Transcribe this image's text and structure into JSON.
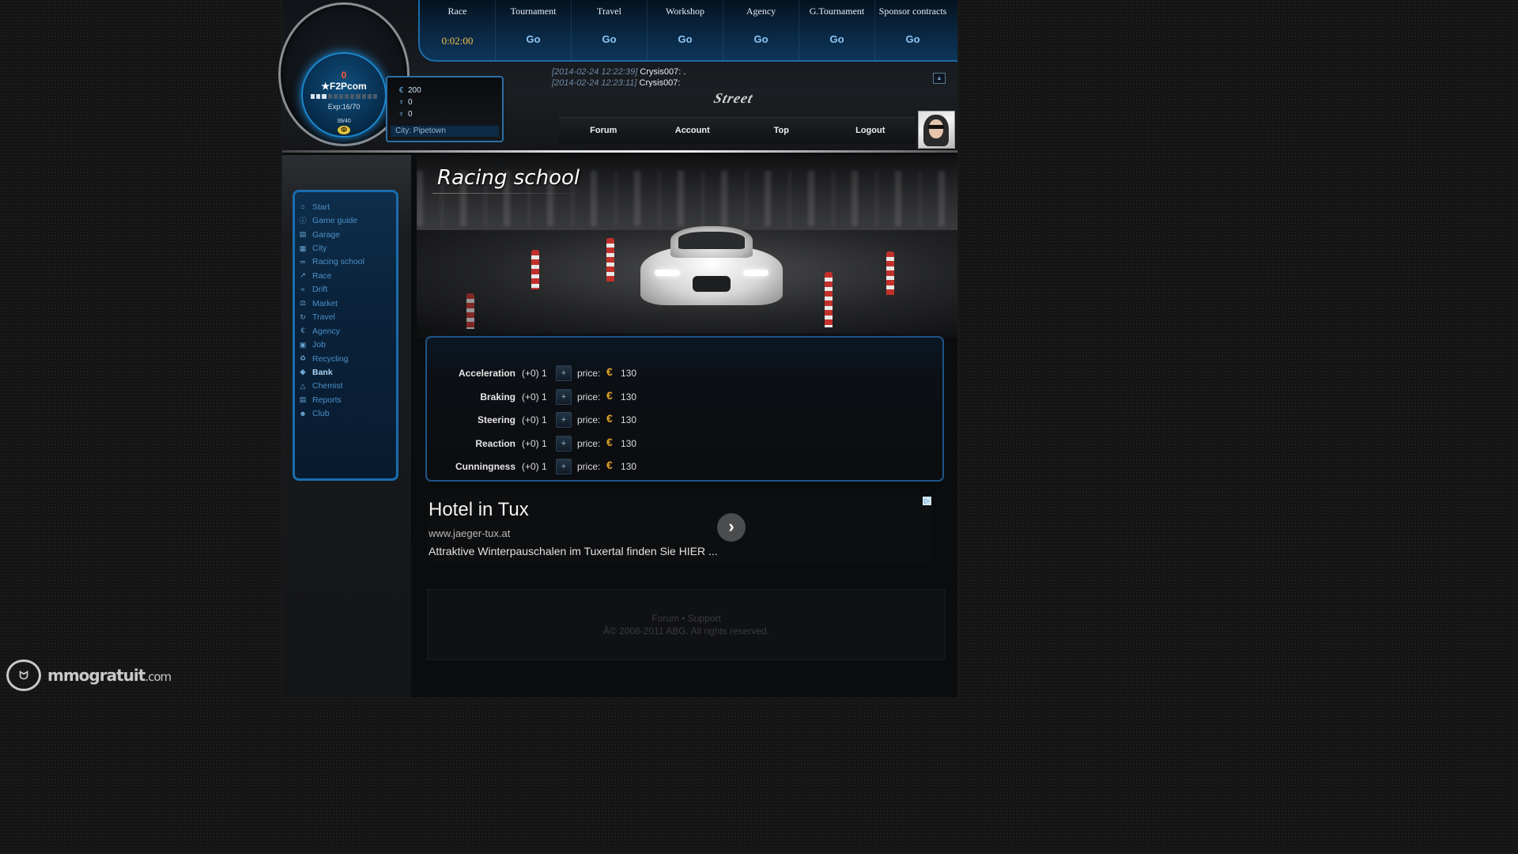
{
  "topnav": [
    {
      "label": "Race",
      "value": "0:02:00",
      "kind": "timer"
    },
    {
      "label": "Tournament",
      "value": "Go",
      "kind": "go"
    },
    {
      "label": "Travel",
      "value": "Go",
      "kind": "go"
    },
    {
      "label": "Workshop",
      "value": "Go",
      "kind": "go"
    },
    {
      "label": "Agency",
      "value": "Go",
      "kind": "go"
    },
    {
      "label": "G.Tournament",
      "value": "Go",
      "kind": "go"
    },
    {
      "label": "Sponsor contracts",
      "value": "Go",
      "kind": "go"
    }
  ],
  "player": {
    "level_number": "0",
    "name": "★F2Pcom",
    "exp": "Exp:16/70",
    "exp_progress": 0.23,
    "energy": "39/40",
    "coin_glyph": "Ф"
  },
  "stats": {
    "money": "200",
    "stat2": "0",
    "stat3": "0",
    "city": "City: Pipetown"
  },
  "chat": [
    {
      "time": "[2014-02-24 12:22:39]",
      "user": "Crysis007: ."
    },
    {
      "time": "[2014-02-24 12:23:11]",
      "user": "Crysis007:"
    }
  ],
  "logo_text": "Street",
  "menu": [
    "Forum",
    "Account",
    "Top",
    "Logout"
  ],
  "sidebar": [
    {
      "label": "Start",
      "icon": "home-icon",
      "glyph": "⌂"
    },
    {
      "label": "Game guide",
      "icon": "info-icon",
      "glyph": "ⓘ"
    },
    {
      "label": "Garage",
      "icon": "garage-icon",
      "glyph": "▤"
    },
    {
      "label": "City",
      "icon": "city-icon",
      "glyph": "▦"
    },
    {
      "label": "Racing school",
      "icon": "school-icon",
      "glyph": "═"
    },
    {
      "label": "Race",
      "icon": "race-icon",
      "glyph": "↗"
    },
    {
      "label": "Drift",
      "icon": "drift-icon",
      "glyph": "≈"
    },
    {
      "label": "Market",
      "icon": "market-icon",
      "glyph": "⚖"
    },
    {
      "label": "Travel",
      "icon": "travel-icon",
      "glyph": "↻"
    },
    {
      "label": "Agency",
      "icon": "euro-icon",
      "glyph": "€"
    },
    {
      "label": "Job",
      "icon": "briefcase-icon",
      "glyph": "▣"
    },
    {
      "label": "Recycling",
      "icon": "recycle-icon",
      "glyph": "♻"
    },
    {
      "label": "Bank",
      "icon": "bank-icon",
      "glyph": "◆",
      "active": true
    },
    {
      "label": "Chemist",
      "icon": "flask-icon",
      "glyph": "△"
    },
    {
      "label": "Reports",
      "icon": "report-icon",
      "glyph": "▤"
    },
    {
      "label": "Club",
      "icon": "club-icon",
      "glyph": "☻"
    }
  ],
  "page": {
    "title": "Racing school"
  },
  "skills": [
    {
      "name": "Acceleration",
      "level": "(+0) 1",
      "plus": "+",
      "price_label": "price:",
      "currency": "€",
      "price": "130"
    },
    {
      "name": "Braking",
      "level": "(+0) 1",
      "plus": "+",
      "price_label": "price:",
      "currency": "€",
      "price": "130"
    },
    {
      "name": "Steering",
      "level": "(+0) 1",
      "plus": "+",
      "price_label": "price:",
      "currency": "€",
      "price": "130"
    },
    {
      "name": "Reaction",
      "level": "(+0) 1",
      "plus": "+",
      "price_label": "price:",
      "currency": "€",
      "price": "130"
    },
    {
      "name": "Cunningness",
      "level": "(+0) 1",
      "plus": "+",
      "price_label": "price:",
      "currency": "€",
      "price": "130"
    }
  ],
  "ad": {
    "title": "Hotel in Tux",
    "url": "www.jaeger-tux.at",
    "text": "Attraktive Winterpauschalen im Tuxertal finden Sie HIER ...",
    "arrow": "›",
    "badge": "▷"
  },
  "footer": {
    "links": "Forum • Support",
    "copyright": "Â© 2008-2011 ABG. All rights reserved."
  },
  "watermark": {
    "brand": "mmogratuit",
    "domain": ".com"
  },
  "colors": {
    "accent": "#1c6ca8",
    "gold": "#e0a227",
    "timer": "#f2c14e",
    "link": "#4b90c9"
  }
}
